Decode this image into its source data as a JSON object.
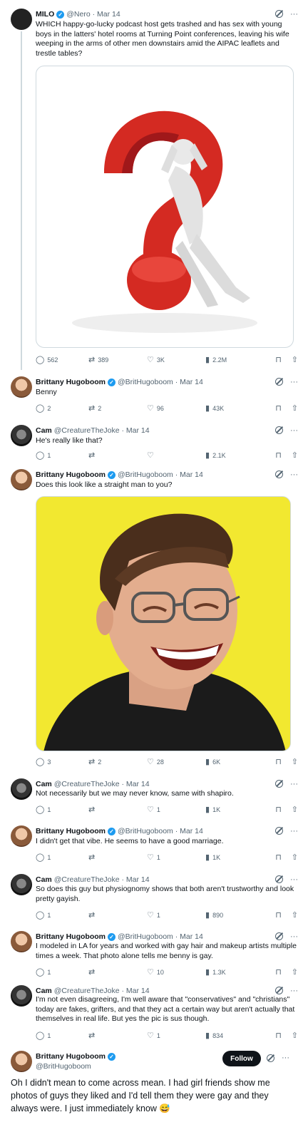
{
  "tweets": [
    {
      "name": "MILO",
      "handle": "@Nero · Mar 14",
      "text": "WHICH happy-go-lucky podcast host gets trashed and has sex with young boys in the latters' hotel rooms at Turning Point conferences, leaving his wife weeping in the arms of other men downstairs amid the AIPAC leaflets and trestle tables?",
      "replies": "562",
      "reposts": "389",
      "likes": "3K",
      "views": "2.2M"
    },
    {
      "name": "Brittany Hugoboom",
      "handle": "@BritHugoboom · Mar 14",
      "text": "Benny",
      "replies": "2",
      "reposts": "2",
      "likes": "96",
      "views": "43K"
    },
    {
      "name": "Cam",
      "handle": "@CreatureTheJoke · Mar 14",
      "text": "He's really like that?",
      "replies": "1",
      "reposts": "",
      "likes": "",
      "views": "2.1K"
    },
    {
      "name": "Brittany Hugoboom",
      "handle": "@BritHugoboom · Mar 14",
      "text": "Does this look like a straight man to you?",
      "replies": "3",
      "reposts": "2",
      "likes": "28",
      "views": "6K"
    },
    {
      "name": "Cam",
      "handle": "@CreatureTheJoke · Mar 14",
      "text": "Not necessarily but we may never know, same with shapiro.",
      "replies": "1",
      "reposts": "",
      "likes": "1",
      "views": "1K"
    },
    {
      "name": "Brittany Hugoboom",
      "handle": "@BritHugoboom · Mar 14",
      "text": "I didn't get that vibe. He seems to have a good marriage.",
      "replies": "1",
      "reposts": "",
      "likes": "1",
      "views": "1K"
    },
    {
      "name": "Cam",
      "handle": "@CreatureTheJoke · Mar 14",
      "text": "So does this guy but physiognomy shows that both aren't trustworthy and look pretty gayish.",
      "replies": "1",
      "reposts": "",
      "likes": "1",
      "views": "890"
    },
    {
      "name": "Brittany Hugoboom",
      "handle": "@BritHugoboom · Mar 14",
      "text": "I modeled in LA for years and worked with gay hair and makeup artists multiple times a week. That photo alone tells me benny is gay.",
      "replies": "1",
      "reposts": "",
      "likes": "10",
      "views": "1.3K"
    },
    {
      "name": "Cam",
      "handle": "@CreatureTheJoke · Mar 14",
      "text": "I'm not even disagreeing, I'm well aware that \"conservatives\" and \"christians\" today are fakes, grifters, and that they act a certain way but aren't actually that themselves in real life. But yes the pic is sus though.",
      "replies": "1",
      "reposts": "",
      "likes": "1",
      "views": "834"
    }
  ],
  "last": {
    "name": "Brittany Hugoboom",
    "handle": "@BritHugoboom",
    "follow_label": "Follow",
    "text": "Oh I didn't mean to come across mean. I had girl friends show me photos of guys they liked and I'd tell them they were gay and they always were. I just immediately know 😅"
  },
  "icons": {
    "reply": "reply-icon",
    "repost": "repost-icon",
    "like": "heart-icon",
    "views": "views-icon",
    "bookmark": "bookmark-icon",
    "share": "share-icon",
    "more": "more-icon",
    "grok": "grok-icon"
  },
  "colors": {
    "verified": "#1d9bf0",
    "muted": "#536471",
    "text": "#0f1419",
    "follow_bg": "#0f1419",
    "media_yellow": "#f2e830",
    "question_red": "#d42a22"
  }
}
